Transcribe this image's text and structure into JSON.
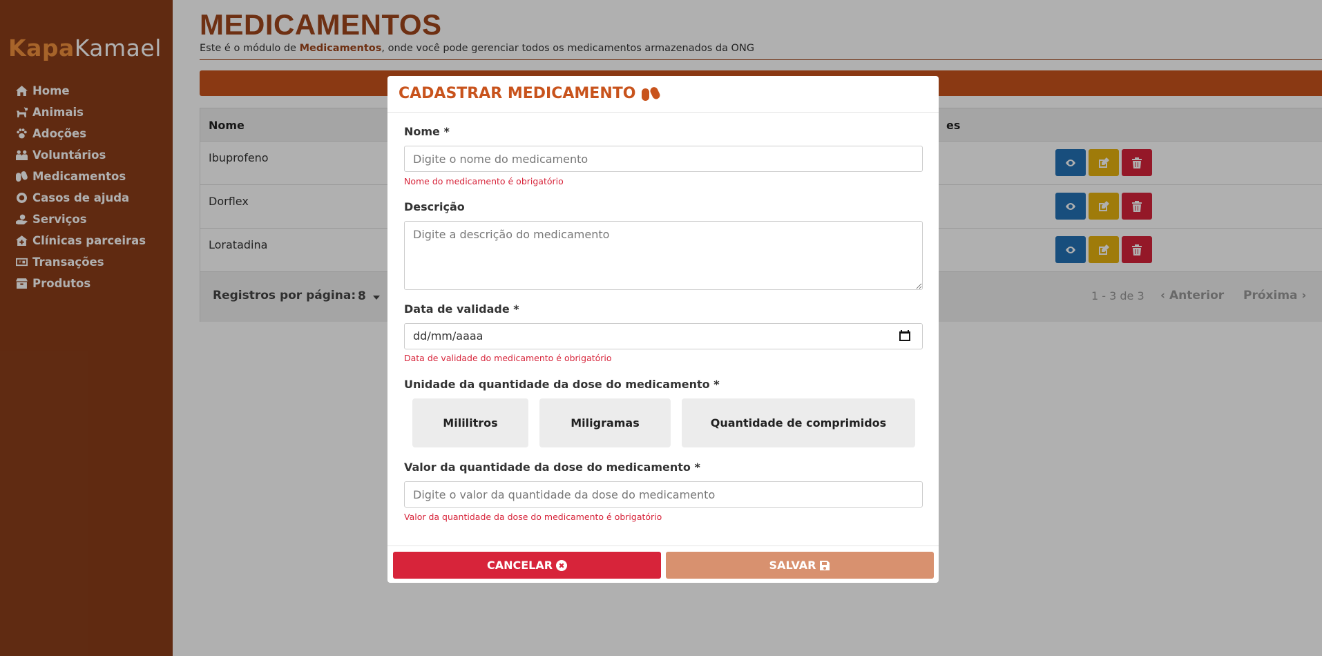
{
  "app": {
    "brand_part1": "Kapa",
    "brand_part2": "Kamael"
  },
  "sidebar": {
    "items": [
      {
        "label": "Home",
        "icon": "home-icon"
      },
      {
        "label": "Animais",
        "icon": "dog-icon"
      },
      {
        "label": "Adoções",
        "icon": "paw-icon"
      },
      {
        "label": "Voluntários",
        "icon": "people-icon"
      },
      {
        "label": "Medicamentos",
        "icon": "pills-icon"
      },
      {
        "label": "Casos de ajuda",
        "icon": "lifebuoy-icon"
      },
      {
        "label": "Serviços",
        "icon": "hand-holding-icon"
      },
      {
        "label": "Clínicas parceiras",
        "icon": "clinic-icon"
      },
      {
        "label": "Transações",
        "icon": "money-icon"
      },
      {
        "label": "Produtos",
        "icon": "box-icon"
      }
    ]
  },
  "page": {
    "title": "MEDICAMENTOS",
    "subtitle_pre": "Este é o módulo de ",
    "subtitle_bold": "Medicamentos",
    "subtitle_post": ", onde você pode gerenciar todos os medicamentos armazenados da ONG"
  },
  "table": {
    "col_nome": "Nome",
    "col_acoes": "es",
    "rows": [
      "Ibuprofeno",
      "Dorflex",
      "Loratadina"
    ],
    "footer": {
      "rows_per_page_label": "Registros por página:",
      "rows_per_page_value": "8",
      "range": "1 - 3 de 3",
      "prev": "Anterior",
      "next": "Próxima"
    }
  },
  "modal": {
    "title": "CADASTRAR MEDICAMENTO",
    "nome": {
      "label": "Nome *",
      "placeholder": "Digite o nome do medicamento",
      "error": "Nome do medicamento é obrigatório"
    },
    "descricao": {
      "label": "Descrição",
      "placeholder": "Digite a descrição do medicamento"
    },
    "validade": {
      "label": "Data de validade *",
      "placeholder": "dd/mm/aaaa",
      "error": "Data de validade do medicamento é obrigatório"
    },
    "unidade": {
      "label": "Unidade da quantidade da dose do medicamento *",
      "options": [
        "Mililitros",
        "Miligramas",
        "Quantidade de comprimidos"
      ]
    },
    "valor": {
      "label": "Valor da quantidade da dose do medicamento *",
      "placeholder": "Digite o valor da quantidade da dose do medicamento",
      "error": "Valor da quantidade da dose do medicamento é obrigatório"
    },
    "cancel_label": "CANCELAR",
    "save_label": "SALVAR"
  },
  "colors": {
    "sidebar": "#8b3e1a",
    "accent": "#c8531c",
    "danger": "#d7243a",
    "info": "#2471b5",
    "warning": "#e6b20f",
    "save_disabled": "#d8916f"
  }
}
